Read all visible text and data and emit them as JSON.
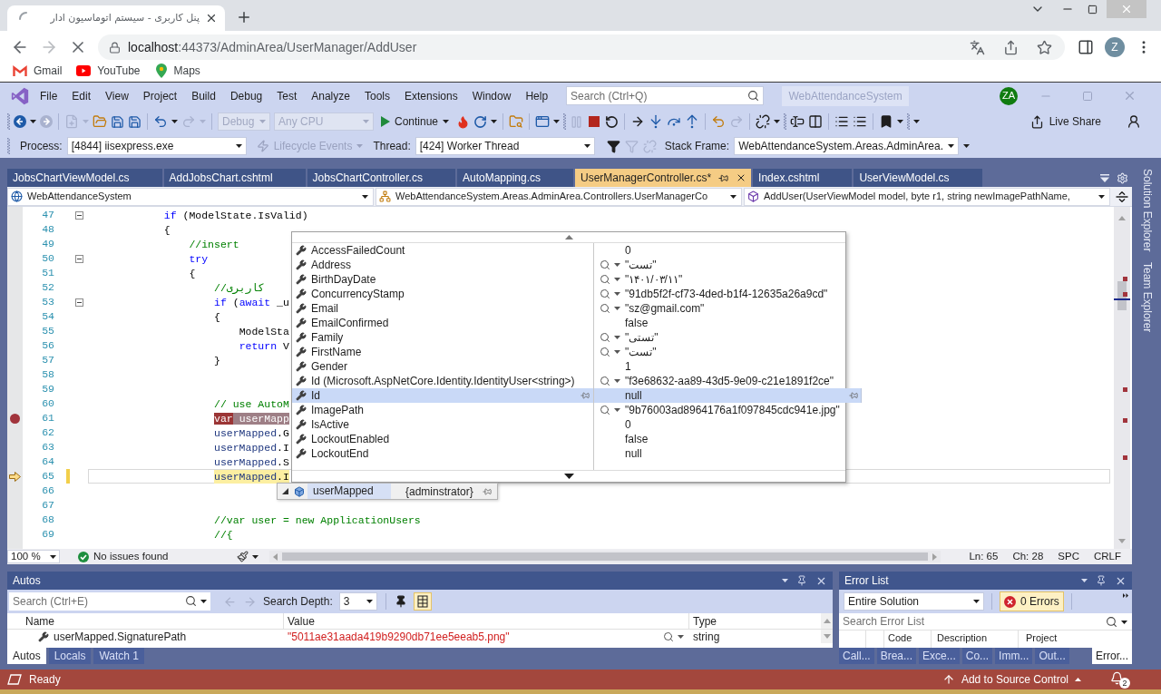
{
  "browser": {
    "tab": {
      "title": "پنل کاربری - سیستم اتوماسیون ادار",
      "loading": true
    },
    "url": "localhost:44373/AdminArea/UserManager/AddUser",
    "profile": "Z",
    "bookmarks": [
      {
        "label": "Gmail",
        "kind": "gmail"
      },
      {
        "label": "YouTube",
        "kind": "youtube"
      },
      {
        "label": "Maps",
        "kind": "maps"
      }
    ]
  },
  "menu": [
    "File",
    "Edit",
    "View",
    "Project",
    "Build",
    "Debug",
    "Test",
    "Analyze",
    "Tools",
    "Extensions",
    "Window",
    "Help"
  ],
  "title_bar": {
    "search_placeholder": "Search (Ctrl+Q)",
    "solution": "WebAttendanceSystem",
    "account": "ZA"
  },
  "toolbar": {
    "configuration": {
      "value": "Debug",
      "disabled": true
    },
    "platform": {
      "value": "Any CPU",
      "disabled": true
    },
    "continue": "Continue",
    "live_share": "Live Share"
  },
  "debug_location": {
    "process_label": "Process:",
    "process": "[4844] iisexpress.exe",
    "lifecycle": {
      "label": "Lifecycle Events",
      "disabled": true
    },
    "thread_label": "Thread:",
    "thread": "[424] Worker Thread",
    "stack_frame_label": "Stack Frame:",
    "stack_frame": "WebAttendanceSystem.Areas.AdminArea."
  },
  "document_tabs": [
    {
      "label": "JobsChartViewModel.cs",
      "selected": false
    },
    {
      "label": "AddJobsChart.cshtml",
      "selected": false
    },
    {
      "label": "JobsChartController.cs",
      "selected": false
    },
    {
      "label": "AutoMapping.cs",
      "selected": false
    },
    {
      "label": "UserManagerController.cs*",
      "selected": true
    },
    {
      "label": "Index.cshtml",
      "selected": false
    },
    {
      "label": "UserViewModel.cs",
      "selected": false
    }
  ],
  "navigation_bar": {
    "project": "WebAttendanceSystem",
    "type": "WebAttendanceSystem.Areas.AdminArea.Controllers.UserManagerCo",
    "member": "AddUser(UserViewModel model, byte r1, string newImagePathName,"
  },
  "code_lines": [
    {
      "number": "47",
      "breakpoint": false,
      "current": false,
      "modified": false,
      "collapsible": true,
      "tokens": [
        {
          "text": "            if",
          "kind": "keyword"
        },
        {
          "text": " (ModelState.IsValid)",
          "kind": "plain"
        }
      ]
    },
    {
      "number": "48",
      "breakpoint": false,
      "current": false,
      "modified": false,
      "collapsible": false,
      "tokens": [
        {
          "text": "            {",
          "kind": "plain"
        }
      ]
    },
    {
      "number": "49",
      "breakpoint": false,
      "current": false,
      "modified": false,
      "collapsible": false,
      "tokens": [
        {
          "text": "                //insert",
          "kind": "comment"
        }
      ]
    },
    {
      "number": "50",
      "breakpoint": false,
      "current": false,
      "modified": false,
      "collapsible": true,
      "tokens": [
        {
          "text": "                try",
          "kind": "keyword"
        }
      ]
    },
    {
      "number": "51",
      "breakpoint": false,
      "current": false,
      "modified": false,
      "collapsible": false,
      "tokens": [
        {
          "text": "                {",
          "kind": "plain"
        }
      ]
    },
    {
      "number": "52",
      "breakpoint": false,
      "current": false,
      "modified": false,
      "collapsible": false,
      "tokens": [
        {
          "text": "                    //کاربری",
          "kind": "comment"
        }
      ]
    },
    {
      "number": "53",
      "breakpoint": false,
      "current": false,
      "modified": false,
      "collapsible": true,
      "tokens": [
        {
          "text": "                    if",
          "kind": "keyword"
        },
        {
          "text": " (",
          "kind": "plain"
        },
        {
          "text": "await",
          "kind": "keyword"
        },
        {
          "text": " _u",
          "kind": "plain"
        }
      ]
    },
    {
      "number": "54",
      "breakpoint": false,
      "current": false,
      "modified": false,
      "collapsible": false,
      "tokens": [
        {
          "text": "                    {",
          "kind": "plain"
        }
      ]
    },
    {
      "number": "55",
      "breakpoint": false,
      "current": false,
      "modified": false,
      "collapsible": false,
      "tokens": [
        {
          "text": "                        ModelSta",
          "kind": "plain"
        }
      ]
    },
    {
      "number": "56",
      "breakpoint": false,
      "current": false,
      "modified": false,
      "collapsible": false,
      "tokens": [
        {
          "text": "                        return",
          "kind": "keyword"
        },
        {
          "text": " V",
          "kind": "plain"
        }
      ]
    },
    {
      "number": "57",
      "breakpoint": false,
      "current": false,
      "modified": false,
      "collapsible": false,
      "tokens": [
        {
          "text": "                    }",
          "kind": "plain"
        }
      ]
    },
    {
      "number": "58",
      "breakpoint": false,
      "current": false,
      "modified": false,
      "collapsible": false
    },
    {
      "number": "59",
      "breakpoint": false,
      "current": false,
      "modified": false,
      "collapsible": false
    },
    {
      "number": "60",
      "breakpoint": false,
      "current": false,
      "modified": false,
      "collapsible": false,
      "tokens": [
        {
          "text": "                    // use AutoM",
          "kind": "comment"
        }
      ]
    },
    {
      "number": "61",
      "breakpoint": true,
      "current": false,
      "modified": false,
      "collapsible": false,
      "tokens": [
        {
          "text": "                    var",
          "kind": "keyword"
        },
        {
          "text": " userMapp",
          "kind": "local"
        }
      ]
    },
    {
      "number": "62",
      "breakpoint": false,
      "current": false,
      "modified": false,
      "collapsible": false,
      "tokens": [
        {
          "text": "                    userMapped",
          "kind": "local"
        },
        {
          "text": ".G",
          "kind": "plain"
        }
      ]
    },
    {
      "number": "63",
      "breakpoint": false,
      "current": false,
      "modified": false,
      "collapsible": false,
      "tokens": [
        {
          "text": "                    userMapped",
          "kind": "local"
        },
        {
          "text": ".I",
          "kind": "plain"
        }
      ]
    },
    {
      "number": "64",
      "breakpoint": false,
      "current": false,
      "modified": false,
      "collapsible": false,
      "tokens": [
        {
          "text": "                    userMapped",
          "kind": "local"
        },
        {
          "text": ".S",
          "kind": "plain"
        }
      ]
    },
    {
      "number": "65",
      "breakpoint": false,
      "current": true,
      "modified": true,
      "collapsible": false,
      "tokens": [
        {
          "text": "                    userMapped",
          "kind": "local"
        },
        {
          "text": ".I",
          "kind": "plain"
        }
      ]
    },
    {
      "number": "66",
      "breakpoint": false,
      "current": false,
      "modified": false,
      "collapsible": false
    },
    {
      "number": "67",
      "breakpoint": false,
      "current": false,
      "modified": false,
      "collapsible": false
    },
    {
      "number": "68",
      "breakpoint": false,
      "current": false,
      "modified": false,
      "collapsible": false,
      "tokens": [
        {
          "text": "                    //var user = new ApplicationUsers",
          "kind": "comment"
        }
      ]
    },
    {
      "number": "69",
      "breakpoint": false,
      "current": false,
      "modified": false,
      "collapsible": false,
      "tokens": [
        {
          "text": "                    //{",
          "kind": "comment"
        }
      ]
    }
  ],
  "datatip": {
    "rows": [
      {
        "name": "AccessFailedCount",
        "value": "0",
        "visualizer": false,
        "selected": false
      },
      {
        "name": "Address",
        "value": "\"تست\"",
        "visualizer": true,
        "selected": false
      },
      {
        "name": "BirthDayDate",
        "value": "\"۱۴۰۱/۰۳/۱۱\"",
        "visualizer": true,
        "selected": false
      },
      {
        "name": "ConcurrencyStamp",
        "value": "\"91db5f2f-cf73-4ded-b1f4-12635a26a9cd\"",
        "visualizer": true,
        "selected": false
      },
      {
        "name": "Email",
        "value": "\"sz@gmail.com\"",
        "visualizer": true,
        "selected": false
      },
      {
        "name": "EmailConfirmed",
        "value": "false",
        "visualizer": false,
        "selected": false
      },
      {
        "name": "Family",
        "value": "\"تستی\"",
        "visualizer": true,
        "selected": false
      },
      {
        "name": "FirstName",
        "value": "\"تست\"",
        "visualizer": true,
        "selected": false
      },
      {
        "name": "Gender",
        "value": "1",
        "visualizer": false,
        "selected": false
      },
      {
        "name": "Id (Microsoft.AspNetCore.Identity.IdentityUser<string>)",
        "value": "\"f3e68632-aa89-43d5-9e09-c21e1891f2ce\"",
        "visualizer": true,
        "selected": false
      },
      {
        "name": "Id",
        "value": "null",
        "visualizer": false,
        "selected": true
      },
      {
        "name": "ImagePath",
        "value": "\"9b76003ad8964176a1f097845cdc941e.jpg\"",
        "visualizer": true,
        "selected": false
      },
      {
        "name": "IsActive",
        "value": "0",
        "visualizer": false,
        "selected": false
      },
      {
        "name": "LockoutEnabled",
        "value": "false",
        "visualizer": false,
        "selected": false
      },
      {
        "name": "LockoutEnd",
        "value": "null",
        "visualizer": false,
        "selected": false
      }
    ]
  },
  "datatip_parent": {
    "name": "userMapped",
    "value": "{adminstrator}",
    "expanded": true
  },
  "editor_status": {
    "zoom": "100 %",
    "issues": "No issues found",
    "position": [
      "Ln: 65",
      "Ch: 28",
      "SPC",
      "CRLF"
    ]
  },
  "side_tabs": [
    "Solution Explorer",
    "Team Explorer"
  ],
  "autos": {
    "title": "Autos",
    "search_placeholder": "Search (Ctrl+E)",
    "depth_label": "Search Depth:",
    "depth": "3",
    "format_toggle": {
      "on": true
    },
    "columns": [
      "Name",
      "Value",
      "Type"
    ],
    "rows": [
      {
        "name": "userMapped.SignaturePath",
        "value": "\"5011ae31aada419b9290db71ee5eeab5.png\"",
        "type": "string",
        "changed": true
      }
    ],
    "tabs": [
      {
        "label": "Autos",
        "selected": true
      },
      {
        "label": "Locals",
        "selected": false
      },
      {
        "label": "Watch 1",
        "selected": false
      }
    ]
  },
  "error_list": {
    "title": "Error List",
    "scope": "Entire Solution",
    "errors": {
      "label": "0 Errors",
      "on": true
    },
    "search_placeholder": "Search Error List",
    "columns": [
      "Code",
      "Description",
      "Project"
    ],
    "tabs": [
      {
        "label": "Call...",
        "selected": false
      },
      {
        "label": "Brea...",
        "selected": false
      },
      {
        "label": "Exce...",
        "selected": false
      },
      {
        "label": "Co...",
        "selected": false
      },
      {
        "label": "Imm...",
        "selected": false
      },
      {
        "label": "Out...",
        "selected": false
      },
      {
        "label": "Error...",
        "selected": true
      }
    ]
  },
  "status_bar": {
    "text": "Ready",
    "source_control": "Add to Source Control",
    "notifications": "2"
  }
}
